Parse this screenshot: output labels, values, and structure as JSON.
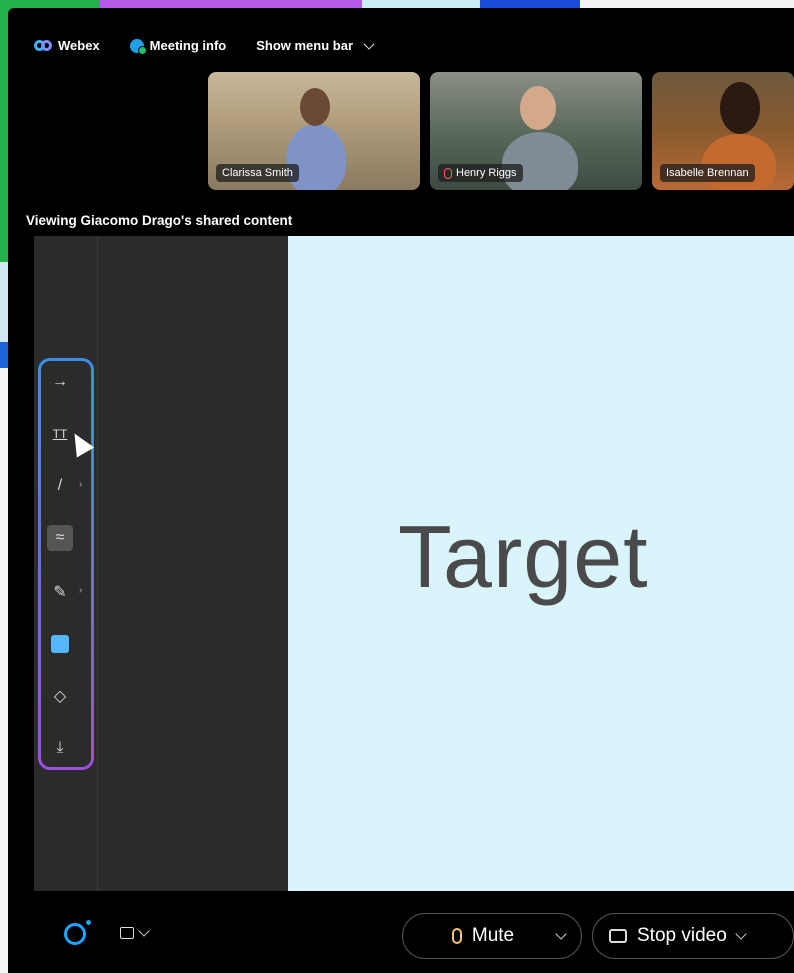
{
  "menubar": {
    "app_label": "Webex",
    "meeting_info_label": "Meeting info",
    "show_menu_bar_label": "Show menu bar"
  },
  "participants": [
    {
      "name": "Clarissa Smith",
      "muted": false
    },
    {
      "name": "Henry Riggs",
      "muted": true
    },
    {
      "name": "Isabelle Brennan",
      "muted": false
    }
  ],
  "sharing": {
    "status_text": "Viewing Giacomo Drago's shared content",
    "canvas_text": "Target",
    "canvas_bg": "#d9f4fb"
  },
  "annotation_toolbar": {
    "tools": [
      {
        "icon": "arrow-right-icon",
        "glyph": "→"
      },
      {
        "icon": "text-tool-icon",
        "glyph": "TT"
      },
      {
        "icon": "line-tool-icon",
        "glyph": "/"
      },
      {
        "icon": "highlighter-icon",
        "glyph": "≈",
        "selected": true
      },
      {
        "icon": "pencil-icon",
        "glyph": "✎"
      },
      {
        "icon": "color-swatch-icon",
        "color": "#56b6ff"
      },
      {
        "icon": "eraser-icon",
        "glyph": "◇"
      },
      {
        "icon": "save-download-icon",
        "glyph": "⤓"
      }
    ]
  },
  "controls": {
    "mute_label": "Mute",
    "stop_video_label": "Stop video"
  }
}
